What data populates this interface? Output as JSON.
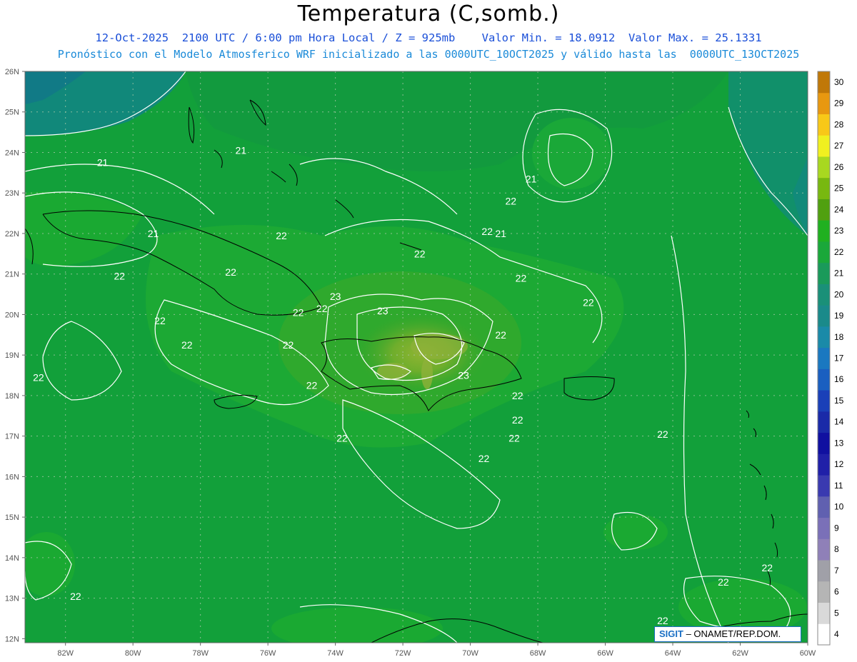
{
  "title": "Temperatura (C,somb.)",
  "subtitle_line1": "12-Oct-2025  2100 UTC / 6:00 pm Hora Local / Z = 925mb    Valor Min. = 18.0912  Valor Max. = 25.1331",
  "subtitle_line2": "Pronóstico con el Modelo Atmosferico WRF inicializado a las 0000UTC_10OCT2025 y válido hasta las  0000UTC_13OCT2025",
  "latitude_labels": [
    "26N",
    "25N",
    "24N",
    "23N",
    "22N",
    "21N",
    "20N",
    "19N",
    "18N",
    "17N",
    "16N",
    "15N",
    "14N",
    "13N",
    "12N"
  ],
  "longitude_labels": [
    "82W",
    "80W",
    "78W",
    "76W",
    "74W",
    "72W",
    "70W",
    "68W",
    "66W",
    "64W",
    "62W",
    "60W"
  ],
  "colorbar": {
    "values": [
      "4",
      "5",
      "6",
      "7",
      "8",
      "9",
      "10",
      "11",
      "12",
      "13",
      "14",
      "15",
      "16",
      "17",
      "18",
      "19",
      "20",
      "21",
      "22",
      "23",
      "24",
      "25",
      "26",
      "27",
      "28",
      "29",
      "30"
    ],
    "colors": [
      "#ffffff",
      "#d9d9d9",
      "#b5b5b5",
      "#a0a0a8",
      "#8f80b8",
      "#7a70b8",
      "#6060b0",
      "#3a3ab0",
      "#2020a8",
      "#1010a0",
      "#1a2aa8",
      "#1a40b8",
      "#1a5fc0",
      "#1a78c0",
      "#1a8aa8",
      "#1a8a8a",
      "#1a9078",
      "#1a9a5a",
      "#1aa83a",
      "#20b020",
      "#50a010",
      "#78b810",
      "#a8d820",
      "#f0f020",
      "#f8c818",
      "#e89810",
      "#c07808"
    ]
  },
  "contour_labels": [
    {
      "text": "21",
      "lon": -80.9,
      "lat": 23.75
    },
    {
      "text": "21",
      "lon": -76.8,
      "lat": 24.05
    },
    {
      "text": "21",
      "lon": -79.4,
      "lat": 22.0
    },
    {
      "text": "22",
      "lon": -75.6,
      "lat": 21.95
    },
    {
      "text": "22",
      "lon": -77.1,
      "lat": 21.05
    },
    {
      "text": "22",
      "lon": -80.4,
      "lat": 20.95
    },
    {
      "text": "22",
      "lon": -75.1,
      "lat": 20.05
    },
    {
      "text": "22",
      "lon": -79.2,
      "lat": 19.85
    },
    {
      "text": "22",
      "lon": -78.4,
      "lat": 19.25
    },
    {
      "text": "22",
      "lon": -75.4,
      "lat": 19.25
    },
    {
      "text": "22",
      "lon": -82.8,
      "lat": 18.45
    },
    {
      "text": "22",
      "lon": -74.7,
      "lat": 18.25
    },
    {
      "text": "22",
      "lon": -74.4,
      "lat": 20.15
    },
    {
      "text": "23",
      "lon": -74.0,
      "lat": 20.45
    },
    {
      "text": "23",
      "lon": -72.6,
      "lat": 20.1
    },
    {
      "text": "22",
      "lon": -71.5,
      "lat": 21.5
    },
    {
      "text": "22",
      "lon": -69.5,
      "lat": 22.05
    },
    {
      "text": "22",
      "lon": -68.5,
      "lat": 20.9
    },
    {
      "text": "22",
      "lon": -66.5,
      "lat": 20.3
    },
    {
      "text": "22",
      "lon": -69.1,
      "lat": 19.5
    },
    {
      "text": "23",
      "lon": -70.2,
      "lat": 18.5
    },
    {
      "text": "22",
      "lon": -68.6,
      "lat": 18.0
    },
    {
      "text": "22",
      "lon": -68.6,
      "lat": 17.4
    },
    {
      "text": "22",
      "lon": -68.7,
      "lat": 16.95
    },
    {
      "text": "22",
      "lon": -73.8,
      "lat": 16.95
    },
    {
      "text": "22",
      "lon": -69.6,
      "lat": 16.45
    },
    {
      "text": "21",
      "lon": -68.2,
      "lat": 23.35
    },
    {
      "text": "22",
      "lon": -68.8,
      "lat": 22.8
    },
    {
      "text": "21",
      "lon": -69.1,
      "lat": 22.0
    },
    {
      "text": "22",
      "lon": -64.3,
      "lat": 17.05
    },
    {
      "text": "22",
      "lon": -81.7,
      "lat": 13.05
    },
    {
      "text": "22",
      "lon": -61.2,
      "lat": 13.75
    },
    {
      "text": "22",
      "lon": -62.5,
      "lat": 13.4
    },
    {
      "text": "22",
      "lon": -64.3,
      "lat": 12.45
    }
  ],
  "credit": {
    "logo": "SIGIT",
    "text": "– ONAMET/REP.DOM."
  }
}
